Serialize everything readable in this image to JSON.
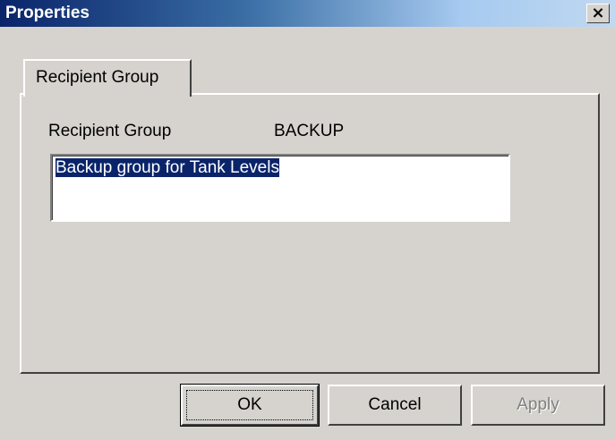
{
  "window": {
    "title": "Properties",
    "close_label": "×"
  },
  "tab": {
    "label": "Recipient Group"
  },
  "form": {
    "field_label": "Recipient Group",
    "field_value": "BACKUP",
    "description_value": "Backup group for Tank Levels"
  },
  "buttons": {
    "ok": "OK",
    "cancel": "Cancel",
    "apply": "Apply",
    "apply_enabled": false
  },
  "colors": {
    "titlebar_start": "#0a246a",
    "face": "#d6d3ce",
    "selection": "#0a246a"
  }
}
